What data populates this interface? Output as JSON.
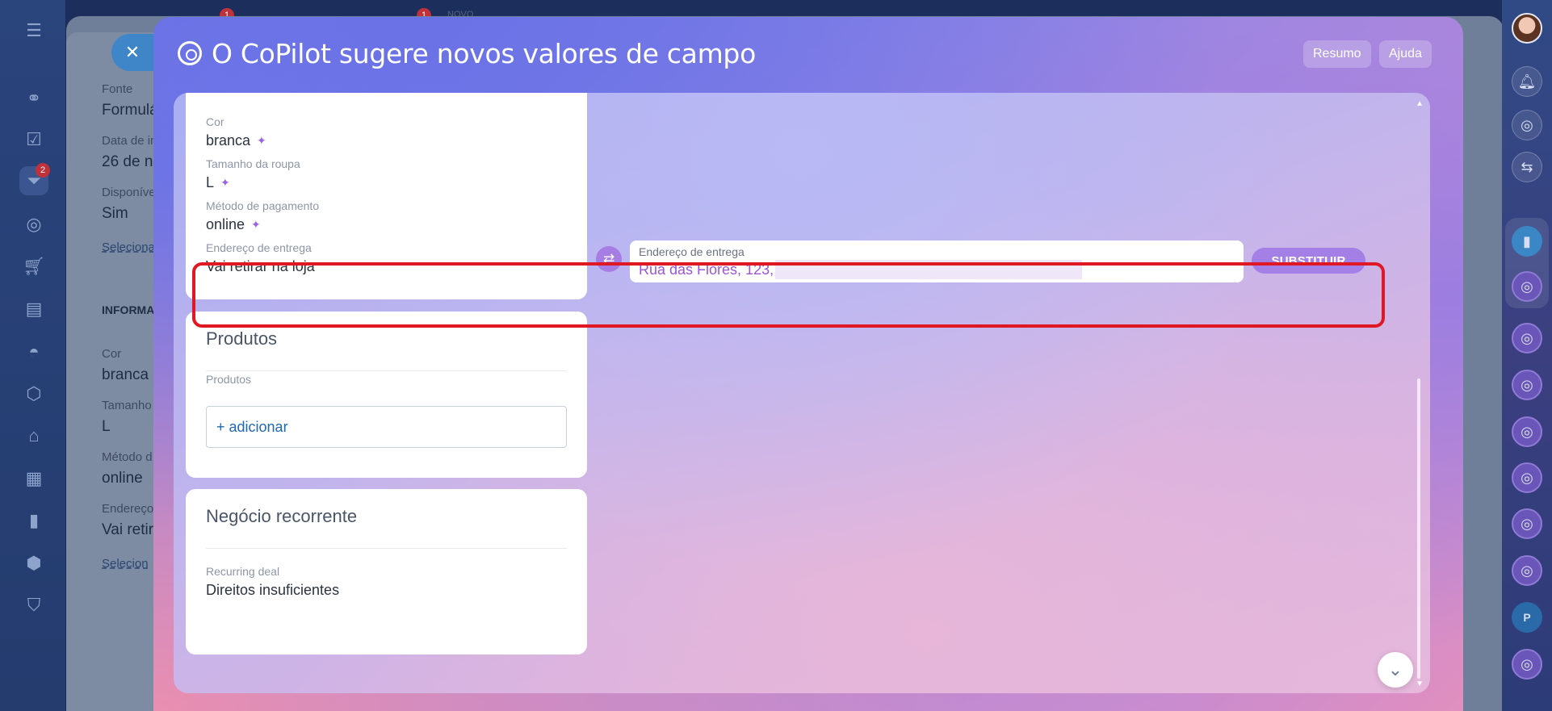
{
  "modal": {
    "title": "O CoPilot sugere novos valores de campo",
    "summary_button": "Resumo",
    "help_button": "Ajuda"
  },
  "fields_card": {
    "fields": [
      {
        "label": "Cor",
        "value": "branca"
      },
      {
        "label": "Tamanho da roupa",
        "value": "L"
      },
      {
        "label": "Método de pagamento",
        "value": "online"
      },
      {
        "label": "Endereço de entrega",
        "value": "Vai retirar na loja"
      }
    ]
  },
  "suggestion": {
    "label": "Endereço de entrega",
    "value": "Rua das Flores, 123,",
    "replace_button": "SUBSTITUIR"
  },
  "products_card": {
    "title": "Produtos",
    "field_label": "Produtos",
    "add_link": "+ adicionar"
  },
  "recurring_card": {
    "title": "Negócio recorrente",
    "field_label": "Recurring deal",
    "field_value": "Direitos insuficientes"
  },
  "background_page": {
    "labels": [
      "Fonte",
      "Data de in",
      "Disponíve",
      "Cor",
      "Tamanho",
      "Método d",
      "Endereço"
    ],
    "values": [
      "Formulá",
      "26 de no",
      "Sim",
      "branca",
      "L",
      "online",
      "Vai retir"
    ],
    "section": "INFORMA",
    "select_link": "Seleciona",
    "select_link_2": "Selecion",
    "top_tabs": {
      "badge_1": "1",
      "badge_2": "1",
      "new_label": "NOVO"
    }
  },
  "sidebar": {
    "badge": "2"
  },
  "right_rail": {
    "p_label": "P"
  },
  "colors": {
    "highlight": "#e01824",
    "accent_purple": "#a47fe6",
    "link_blue": "#2068ad"
  }
}
